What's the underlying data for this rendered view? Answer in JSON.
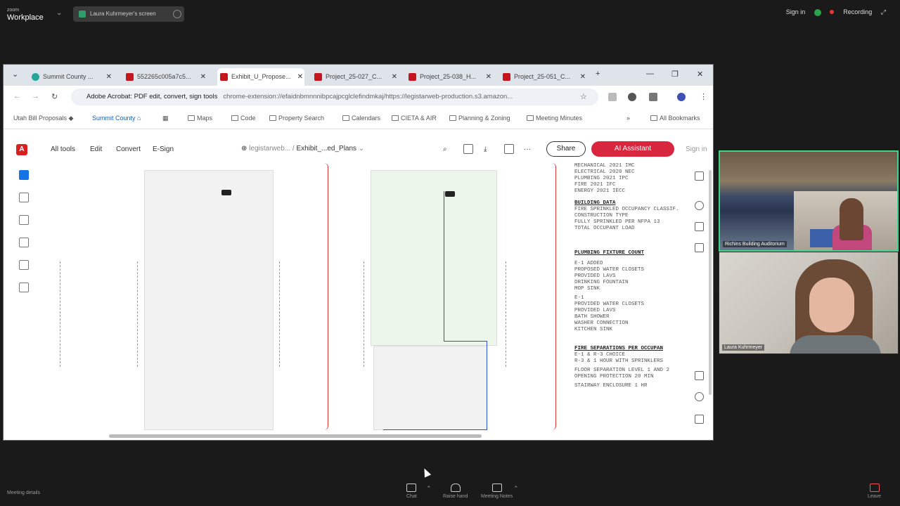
{
  "zoom": {
    "logo_small": "zoom",
    "logo": "Workplace",
    "share_label": "Laura Kuhrmeyer's screen",
    "sign_in": "Sign in",
    "recording": "Recording"
  },
  "tabs": [
    {
      "label": "Summit County ..."
    },
    {
      "label": "552265c005a7c5..."
    },
    {
      "label": "Exhibit_U_Propose..."
    },
    {
      "label": "Project_25-027_C..."
    },
    {
      "label": "Project_25-038_H..."
    },
    {
      "label": "Project_25-051_C..."
    }
  ],
  "address": {
    "site": "Adobe Acrobat: PDF edit, convert, sign tools",
    "url": "chrome-extension://efaidnbmnnnibpcajpcglclefindmkaj/https://legistarweb-production.s3.amazon..."
  },
  "bookmarks": [
    {
      "label": "Utah Bill Proposals"
    },
    {
      "label": "Summit County"
    },
    {
      "label": "Maps"
    },
    {
      "label": "Code"
    },
    {
      "label": "Property Search"
    },
    {
      "label": "Calendars"
    },
    {
      "label": "CIETA & AIR"
    },
    {
      "label": "Planning & Zoning"
    },
    {
      "label": "Meeting Minutes"
    },
    {
      "label": "All Bookmarks"
    }
  ],
  "acrobat": {
    "menu": [
      "All tools",
      "Edit",
      "Convert",
      "E-Sign"
    ],
    "path_folder": "legistarweb...",
    "path_file": "Exhibit_...ed_Plans",
    "share": "Share",
    "ai_assistant": "AI Assistant",
    "sign_in": "Sign in"
  },
  "notes": {
    "codes": [
      "MECHANICAL 2021 IMC",
      "ELECTRICAL 2020 NEC",
      "PLUMBING 2021 IPC",
      "FIRE 2021 IFC",
      "ENERGY 2021 IECC"
    ],
    "building_data_h": "BUILDING DATA",
    "building_data": [
      "FIRE SPRINKLED OCCUPANCY CLASSIF.",
      "CONSTRUCTION TYPE",
      "FULLY SPRINKLED PER NFPA 13",
      "TOTAL OCCUPANT LOAD"
    ],
    "plumbing_h": "PLUMBING FIXTURE COUNT",
    "plumbing": [
      "E-1 ADDED",
      "PROPOSED WATER CLOSETS",
      "PROVIDED LAVS",
      "DRINKING FOUNTAIN",
      "MOP SINK",
      "E-1",
      "PROVIDED WATER CLOSETS",
      "PROVIDED LAVS",
      "BATH SHOWER",
      "WASHER CONNECTION",
      "KITCHEN SINK"
    ],
    "fire_h": "FIRE SEPARATIONS PER OCCUPAN",
    "fire": [
      "E-1 & R-3 CHOICE",
      "R-3 & 1 HOUR WITH SPRINKLERS",
      "FLOOR SEPARATION LEVEL 1 AND 2",
      "OPENING PROTECTION 20 MIN",
      "STAIRWAY ENCLOSURE 1 HR"
    ]
  },
  "videos": [
    {
      "name": "Richins Building Auditorium"
    },
    {
      "name": "Laura Kuhrmeyer"
    }
  ],
  "bottom": [
    {
      "label": "Chat"
    },
    {
      "label": "Raise hand"
    },
    {
      "label": "Meeting Notes"
    }
  ],
  "bottom_left": "Meeting details",
  "bottom_right": "Leave"
}
